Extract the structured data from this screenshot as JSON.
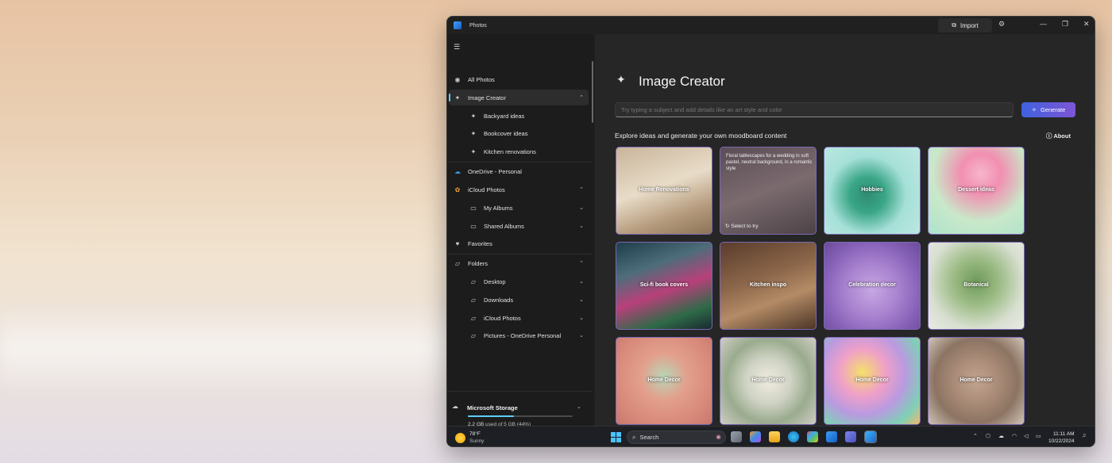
{
  "window": {
    "app_title": "Photos",
    "import_label": "Import",
    "settings_icon": "gear-icon",
    "min_icon": "minimize-icon",
    "restore_icon": "restore-icon",
    "close_icon": "close-icon"
  },
  "sidebar": {
    "items": [
      {
        "label": "All Photos",
        "icon": "gallery-icon"
      },
      {
        "label": "Image Creator",
        "icon": "image-sparkle-icon",
        "expanded": true,
        "active": true
      },
      {
        "label": "Backyard ideas",
        "icon": "image-sparkle-icon"
      },
      {
        "label": "Bookcover ideas",
        "icon": "image-sparkle-icon"
      },
      {
        "label": "Kitchen renovations",
        "icon": "image-sparkle-icon"
      },
      {
        "label": "OneDrive - Personal",
        "icon": "cloud-icon"
      },
      {
        "label": "iCloud Photos",
        "icon": "icloud-icon",
        "expanded": true
      },
      {
        "label": "My Albums",
        "icon": "album-icon"
      },
      {
        "label": "Shared Albums",
        "icon": "album-icon"
      },
      {
        "label": "Favorites",
        "icon": "heart-icon"
      },
      {
        "label": "Folders",
        "icon": "folder-icon",
        "expanded": true
      },
      {
        "label": "Desktop",
        "icon": "folder-icon"
      },
      {
        "label": "Downloads",
        "icon": "folder-icon"
      },
      {
        "label": "iCloud Photos",
        "icon": "folder-icon"
      },
      {
        "label": "Pictures - OneDrive Personal",
        "icon": "folder-icon"
      }
    ],
    "storage": {
      "title": "Microsoft Storage",
      "used": "2.2 GB",
      "rest": "used of 5 GB (44%)",
      "fraction": 0.44,
      "accent": "#60cdff"
    }
  },
  "main": {
    "title": "Image Creator",
    "prompt_placeholder": "Try typing a subject and add details like an art style and color",
    "generate_label": "Generate",
    "explore_label": "Explore ideas and generate your own moodboard content",
    "about_label": "About",
    "tiles": [
      {
        "label": "Home Renovations"
      },
      {
        "label": "",
        "prompt": "Floral tablescapes for a wedding in soft pastel, neutral background, in a romantic style",
        "select": "Select to try"
      },
      {
        "label": "Hobbies"
      },
      {
        "label": "Dessert ideas"
      },
      {
        "label": "Sci-fi book covers"
      },
      {
        "label": "Kitchen inspo"
      },
      {
        "label": "Celebration decor"
      },
      {
        "label": "Botanical"
      },
      {
        "label": "Home Decor"
      },
      {
        "label": "Home Decor"
      },
      {
        "label": "Home Decor"
      },
      {
        "label": "Home Decor"
      }
    ]
  },
  "taskbar": {
    "weather_temp": "78°F",
    "weather_cond": "Sunny",
    "search_label": "Search",
    "time": "11:11 AM",
    "date": "10/22/2024"
  }
}
